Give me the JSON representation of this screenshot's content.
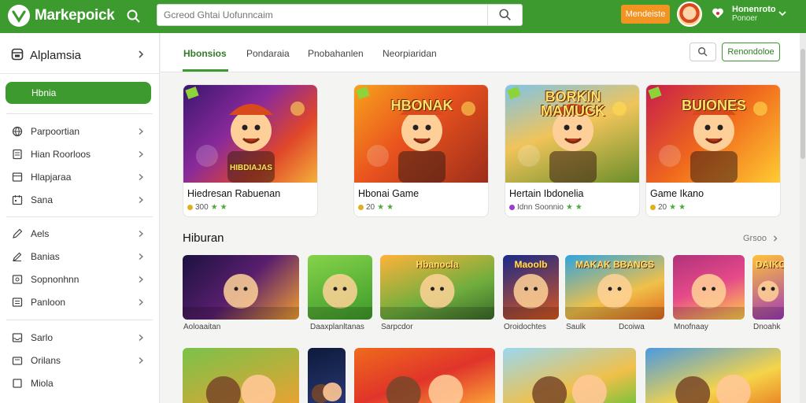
{
  "app": {
    "name": "Markepoick",
    "search_placeholder": "Gcreod Ghtai Uofunncaim",
    "promo_label": "Mendeiste",
    "user_name": "Honenroto",
    "user_sub": "Ponoer",
    "colors": {
      "brand": "#3d9a2e",
      "accent": "#f39322"
    }
  },
  "sidebar": {
    "header_title": "Alplamsia",
    "active_item": "Hbnia",
    "groups": [
      [
        {
          "label": "Parpoortian",
          "icon": "globe-icon"
        },
        {
          "label": "Hian Roorloos",
          "icon": "document-icon"
        },
        {
          "label": "Hlapjaraa",
          "icon": "list-icon"
        },
        {
          "label": "Sana",
          "icon": "calendar-icon"
        }
      ],
      [
        {
          "label": "Aels",
          "icon": "pencil-icon"
        },
        {
          "label": "Banias",
          "icon": "edit-icon"
        },
        {
          "label": "Sopnonhnn",
          "icon": "image-icon"
        },
        {
          "label": "Panloon",
          "icon": "menu-icon"
        }
      ],
      [
        {
          "label": "Sarlo",
          "icon": "inbox-icon"
        },
        {
          "label": "Orilans",
          "icon": "folder-icon"
        },
        {
          "label": "Miola",
          "icon": "square-icon"
        }
      ]
    ]
  },
  "tabs": [
    "Hbonsios",
    "Pondaraia",
    "Pnobahanlen",
    "Neorpiaridan"
  ],
  "tab_cta": "Renondoloe",
  "featured": [
    {
      "title": "Hiedresan Rabuenan",
      "meta": "300",
      "dot": "#e0b020"
    },
    {
      "title": "Hbonai Game",
      "meta": "20",
      "dot": "#e0b020"
    },
    {
      "title": "Hertain Ibdonelia",
      "meta": "Idnn Soonnio",
      "dot": "#9b3dcc"
    },
    {
      "title": "Game Ikano",
      "meta": "20",
      "dot": "#e0b020"
    }
  ],
  "featured_art": [
    "HIBDIAJAS",
    "HBONAK",
    "BORKIN MAMUCK",
    "BUIONES"
  ],
  "section": {
    "title": "Hiburan",
    "see_all": "Grsoo"
  },
  "small_cards": [
    {
      "label": "Aoloaaitan"
    },
    {
      "label": "Daaxplanltanas"
    },
    {
      "label": "Sarpcdor"
    },
    {
      "label": "Oroidochtes"
    },
    {
      "label": "Saulk"
    },
    {
      "label": "Dcoiwa"
    },
    {
      "label": "Mnofnaay"
    },
    {
      "label": "Dnoahk"
    }
  ],
  "small_art": [
    "",
    "",
    "Hbanocla",
    "Maoolb",
    "MAKAK BBANGS",
    "",
    "DAIKCR",
    ""
  ]
}
